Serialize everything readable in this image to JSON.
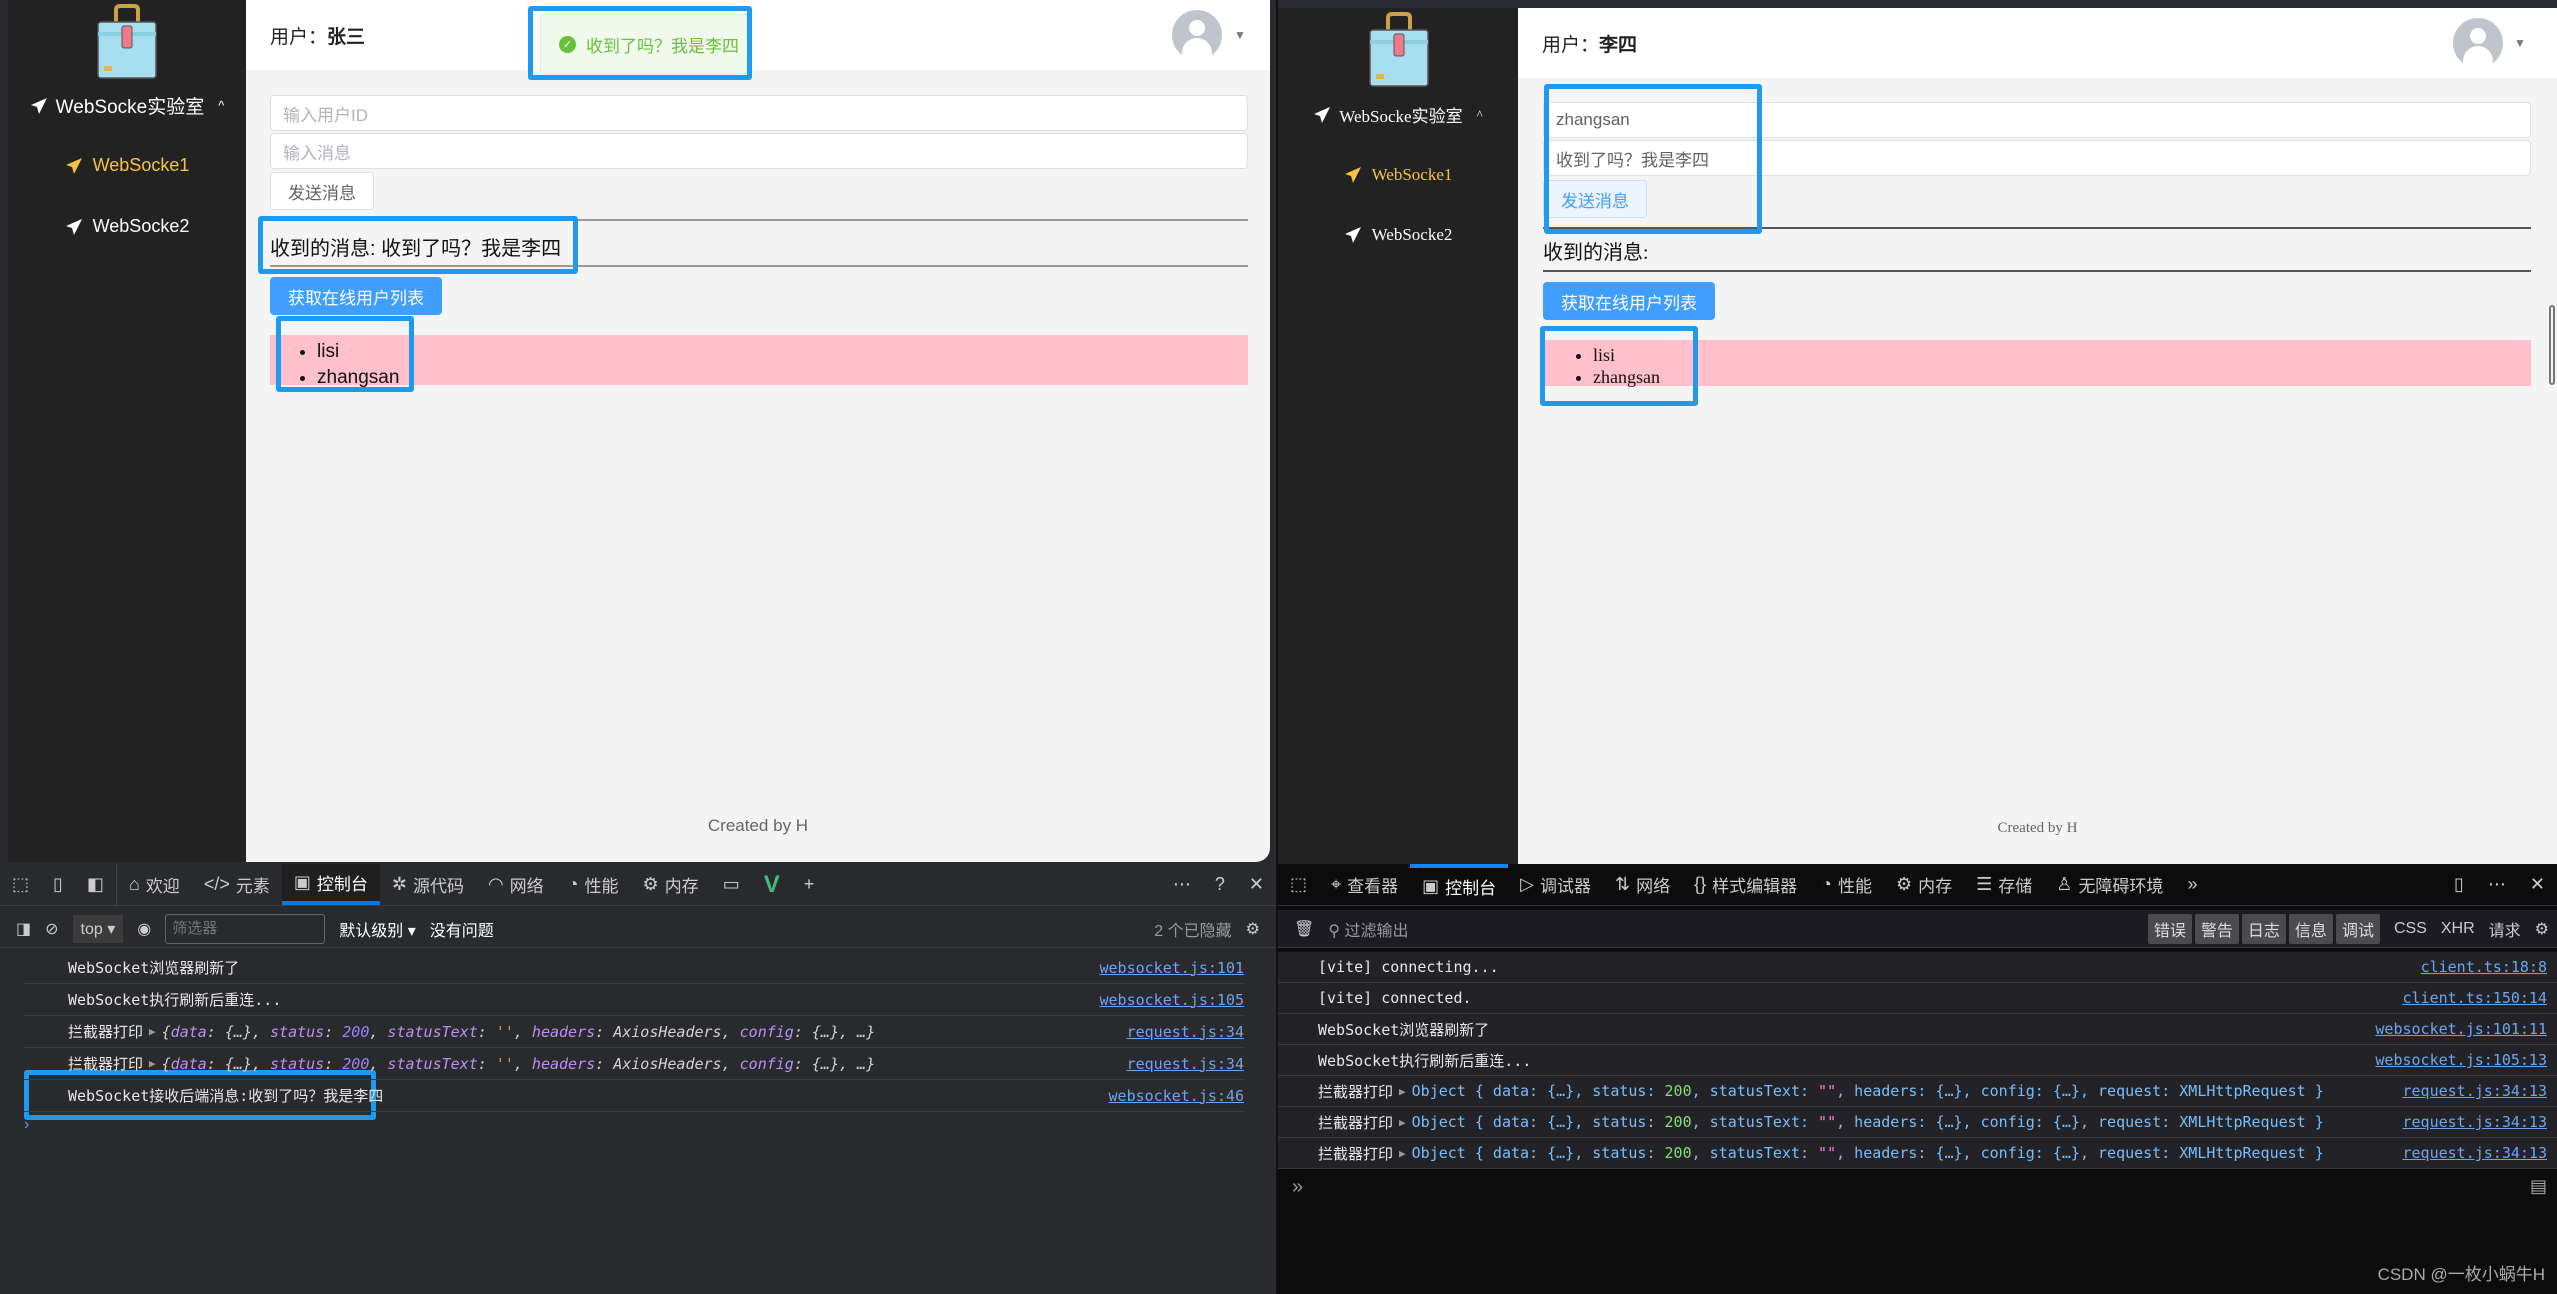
{
  "left": {
    "sidebar": {
      "group_label": "WebSocke实验室",
      "items": [
        {
          "label": "WebSocke1",
          "active": true
        },
        {
          "label": "WebSocke2",
          "active": false
        }
      ]
    },
    "header": {
      "user_prefix": "用户：",
      "user_name": "张三"
    },
    "toast": {
      "message": "收到了吗？我是李四",
      "type": "success"
    },
    "form": {
      "user_id": {
        "value": "",
        "placeholder": "输入用户ID"
      },
      "message": {
        "value": "",
        "placeholder": "输入消息"
      },
      "send_label": "发送消息"
    },
    "received": "收到的消息: 收到了吗？我是李四",
    "get_users_label": "获取在线用户列表",
    "online_users": [
      "lisi",
      "zhangsan"
    ],
    "footer": "Created by H",
    "devtools": {
      "tabs": [
        {
          "icon": "home-icon",
          "label": "欢迎"
        },
        {
          "icon": "code-icon",
          "label": "元素"
        },
        {
          "icon": "console-icon",
          "label": "控制台",
          "active": true
        },
        {
          "icon": "bug-icon",
          "label": "源代码"
        },
        {
          "icon": "wifi-icon",
          "label": "网络"
        },
        {
          "icon": "gauge-icon",
          "label": "性能"
        },
        {
          "icon": "chip-icon",
          "label": "内存"
        }
      ],
      "context": "top",
      "filter_placeholder": "筛选器",
      "level": "默认级别",
      "issues": "没有问题",
      "hidden": "2 个已隐藏",
      "logs": [
        {
          "text": "WebSocket浏览器刷新了",
          "source": "websocket.js:101"
        },
        {
          "text": "WebSocket执行刷新后重连...",
          "source": "websocket.js:105"
        },
        {
          "text": "拦截器打印",
          "object": true,
          "source": "request.js:34"
        },
        {
          "text": "拦截器打印",
          "object": true,
          "source": "request.js:34"
        },
        {
          "text": "WebSocket接收后端消息:收到了吗？我是李四",
          "source": "websocket.js:46"
        }
      ],
      "object_parts": {
        "data": "data",
        "status": "status",
        "status_value": "200",
        "statusText": "statusText",
        "statusText_value": "''",
        "headers": "headers",
        "headers_value": "AxiosHeaders",
        "config": "config"
      }
    }
  },
  "right": {
    "sidebar": {
      "group_label": "WebSocke实验室",
      "items": [
        {
          "label": "WebSocke1",
          "active": true
        },
        {
          "label": "WebSocke2",
          "active": false
        }
      ]
    },
    "header": {
      "user_prefix": "用户：",
      "user_name": "李四"
    },
    "form": {
      "user_id": {
        "value": "zhangsan",
        "placeholder": "输入用户ID"
      },
      "message": {
        "value": "收到了吗？我是李四",
        "placeholder": "输入消息"
      },
      "send_label": "发送消息"
    },
    "received": "收到的消息:",
    "get_users_label": "获取在线用户列表",
    "online_users": [
      "lisi",
      "zhangsan"
    ],
    "footer": "Created by H",
    "devtools": {
      "tabs": [
        {
          "icon": "inspector-icon",
          "label": "查看器"
        },
        {
          "icon": "console-icon",
          "label": "控制台",
          "active": true
        },
        {
          "icon": "debugger-icon",
          "label": "调试器"
        },
        {
          "icon": "network-icon",
          "label": "网络"
        },
        {
          "icon": "braces-icon",
          "label": "样式编辑器"
        },
        {
          "icon": "performance-icon",
          "label": "性能"
        },
        {
          "icon": "memory-icon",
          "label": "内存"
        },
        {
          "icon": "storage-icon",
          "label": "存储"
        },
        {
          "icon": "accessibility-icon",
          "label": "无障碍环境"
        }
      ],
      "filter_placeholder": "过滤输出",
      "levels": [
        "错误",
        "警告",
        "日志",
        "信息",
        "调试"
      ],
      "extra_filters": [
        "CSS",
        "XHR",
        "请求"
      ],
      "logs": [
        {
          "text": "[vite] connecting...",
          "source": "client.ts:18:8"
        },
        {
          "text": "[vite] connected.",
          "source": "client.ts:150:14"
        },
        {
          "text": "WebSocket浏览器刷新了",
          "source": "websocket.js:101:11"
        },
        {
          "text": "WebSocket执行刷新后重连...",
          "source": "websocket.js:105:13"
        },
        {
          "text": "拦截器打印",
          "object": true,
          "source": "request.js:34:13"
        },
        {
          "text": "拦截器打印",
          "object": true,
          "source": "request.js:34:13"
        },
        {
          "text": "拦截器打印",
          "object": true,
          "source": "request.js:34:13"
        }
      ],
      "object_text": {
        "prefix": "Object { data: {…}, status: ",
        "status": "200",
        "mid": ", statusText: ",
        "st": "\"\"",
        "suffix": ", headers: {…}, config: {…}, request: XMLHttpRequest }"
      }
    }
  },
  "watermark": "CSDN @一枚小蜗牛H"
}
